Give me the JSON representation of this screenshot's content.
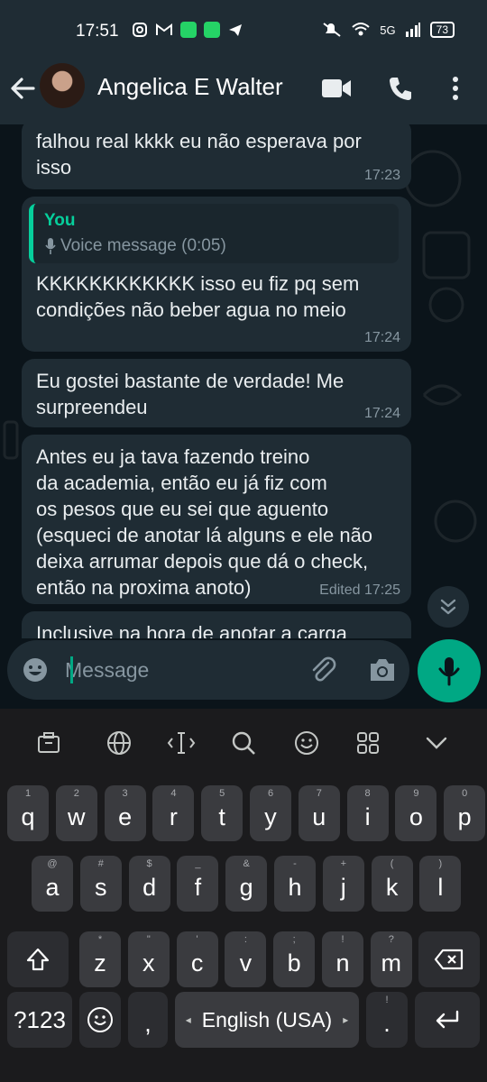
{
  "status_bar": {
    "time": "17:51",
    "network": "5G",
    "battery": "73"
  },
  "header": {
    "contact_name": "Angelica E Walter"
  },
  "messages": [
    {
      "text": "falhou real kkkk eu não esperava por\nisso",
      "time": "17:23"
    },
    {
      "quote_author": "You",
      "quote_text": "Voice message (0:05)",
      "text": "KKKKKKKKKKKK isso eu fiz pq sem\ncondições não beber agua no meio",
      "time": "17:24"
    },
    {
      "text": "Eu gostei bastante de verdade! Me\nsurpreendeu",
      "time": "17:24"
    },
    {
      "text": "Antes eu ja tava fazendo treino\nda academia, então eu já fiz com\nos pesos que eu sei que aguento\n(esqueci de anotar lá alguns e ele não\ndeixa arrumar depois que dá o check,\nentão na proxima anoto)",
      "time": "Edited 17:25"
    },
    {
      "text": "Inclusive na hora de anotar a carga"
    }
  ],
  "composer": {
    "placeholder": "Message"
  },
  "keyboard": {
    "row1": [
      {
        "k": "q",
        "h": "1"
      },
      {
        "k": "w",
        "h": "2"
      },
      {
        "k": "e",
        "h": "3"
      },
      {
        "k": "r",
        "h": "4"
      },
      {
        "k": "t",
        "h": "5"
      },
      {
        "k": "y",
        "h": "6"
      },
      {
        "k": "u",
        "h": "7"
      },
      {
        "k": "i",
        "h": "8"
      },
      {
        "k": "o",
        "h": "9"
      },
      {
        "k": "p",
        "h": "0"
      }
    ],
    "row2": [
      {
        "k": "a",
        "h": "@"
      },
      {
        "k": "s",
        "h": "#"
      },
      {
        "k": "d",
        "h": "$"
      },
      {
        "k": "f",
        "h": "_"
      },
      {
        "k": "g",
        "h": "&"
      },
      {
        "k": "h",
        "h": "-"
      },
      {
        "k": "j",
        "h": "+"
      },
      {
        "k": "k",
        "h": "("
      },
      {
        "k": "l",
        "h": ")"
      }
    ],
    "row3": [
      {
        "k": "z",
        "h": "*"
      },
      {
        "k": "x",
        "h": "\""
      },
      {
        "k": "c",
        "h": "'"
      },
      {
        "k": "v",
        "h": ":"
      },
      {
        "k": "b",
        "h": ";"
      },
      {
        "k": "n",
        "h": "!"
      },
      {
        "k": "m",
        "h": "?"
      }
    ],
    "symbols_label": "?123",
    "comma": ",",
    "space_label": "English (USA)",
    "period": ".",
    "period_hint": "!"
  }
}
